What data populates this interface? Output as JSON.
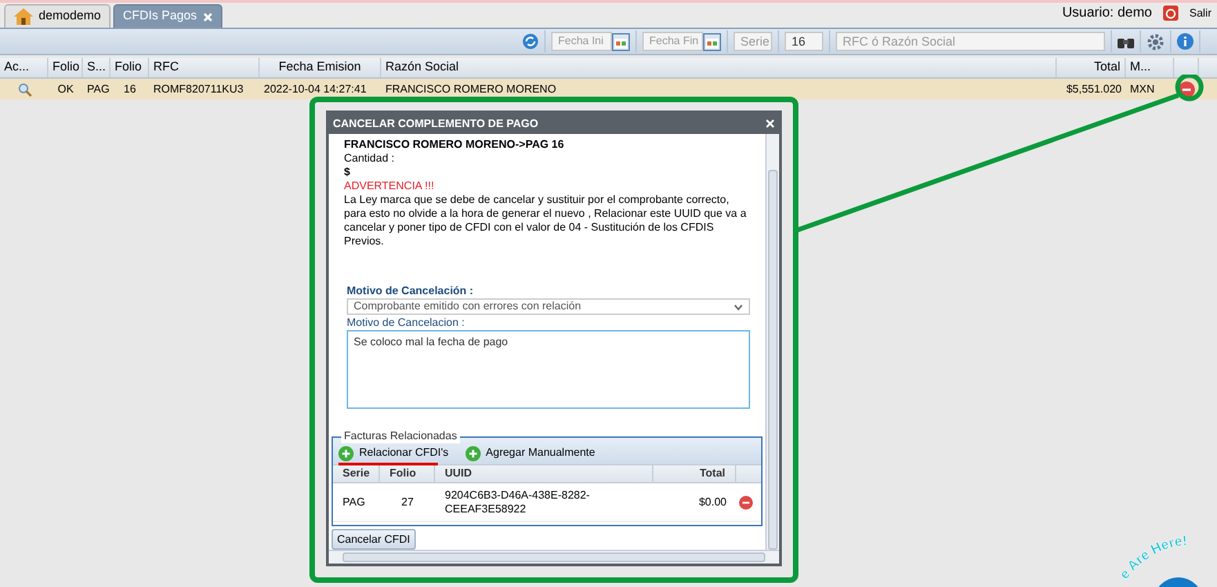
{
  "tabs": [
    {
      "label": "demodemo",
      "selected": false,
      "kind": "home"
    },
    {
      "label": "CFDIs Pagos",
      "selected": true,
      "kind": "closable"
    }
  ],
  "user": {
    "label": "Usuario: demo",
    "logout": "Salir"
  },
  "toolbar": {
    "fecha_ini": {
      "placeholder": "Fecha Ini"
    },
    "fecha_fin": {
      "placeholder": "Fecha Fin"
    },
    "serie": {
      "placeholder": "Serie"
    },
    "folio": {
      "value": "16"
    },
    "search": {
      "placeholder": "RFC ó Razón Social"
    }
  },
  "table": {
    "action_column": "Ac...",
    "columns": [
      "Folio",
      "S...",
      "Folio",
      "RFC",
      "Fecha Emision",
      "Razón Social",
      "Total",
      "M..."
    ],
    "rows": [
      {
        "selected": true,
        "cells": [
          "OK",
          "PAG",
          "16",
          "ROMF820711KU3",
          "2022-10-04 14:27:41",
          "FRANCISCO ROMERO MORENO",
          "$5,551.020",
          "MXN"
        ]
      }
    ]
  },
  "dialog": {
    "title": "CANCELAR COMPLEMENTO DE PAGO",
    "heading": "FRANCISCO ROMERO MORENO->PAG 16",
    "amount_label": "Cantidad :",
    "amount": "$",
    "warning": "ADVERTENCIA !!!",
    "message": "La Ley marca que se debe de cancelar y sustituir por el comprobante correcto, para esto no olvide a la hora de generar el nuevo , Relacionar este UUID que va a cancelar y poner tipo de CFDI con el valor de 04 - Sustitución de los CFDIS Previos.",
    "reason_label": "Motivo de Cancelación :",
    "reason_value": "Comprobante emitido con errores con relación",
    "note_label": "Motivo de Cancelacion :",
    "note_value": "Se coloco mal la fecha de pago",
    "related": {
      "legend": "Facturas Relacionadas",
      "buttons": [
        "Relacionar CFDI's",
        "Agregar Manualmente"
      ],
      "columns": [
        "Serie",
        "Folio",
        "UUID",
        "Total"
      ],
      "rows": [
        {
          "cells": [
            "PAG",
            "27",
            "9204C6B3-D46A-438E-8282-CEEAF3E58922",
            "$0.00"
          ]
        }
      ]
    },
    "submit": "Cancelar CFDI"
  },
  "chat_badge": {
    "label": "e Are Here!"
  }
}
